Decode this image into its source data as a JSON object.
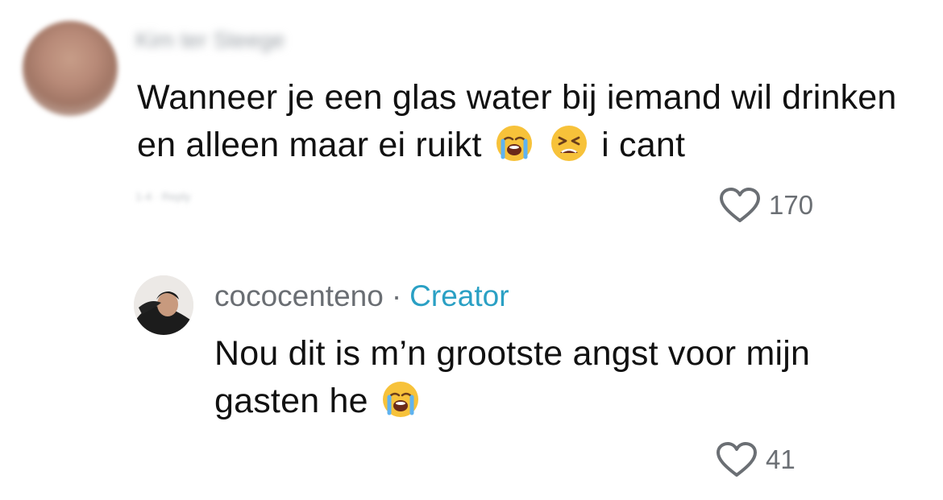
{
  "comments": [
    {
      "author": "Kim ter Steege",
      "text_before": "Wanneer je een glas water bij iemand wil drinken en alleen maar ei ruikt",
      "emojis": [
        "loudly-crying-face-emoji",
        "tired-face-emoji"
      ],
      "text_after": "i cant",
      "meta": "1-4 · Reply",
      "likes": "170"
    },
    {
      "author": "cococenteno",
      "separator": "·",
      "badge": "Creator",
      "text_before": "Nou dit is m’n grootste angst voor mijn gasten he",
      "emojis": [
        "loudly-crying-face-emoji"
      ],
      "likes": "41"
    }
  ],
  "colors": {
    "text": "#111111",
    "muted": "#6a6e73",
    "creator": "#2aa0c4",
    "heart": "#6b6f74"
  }
}
